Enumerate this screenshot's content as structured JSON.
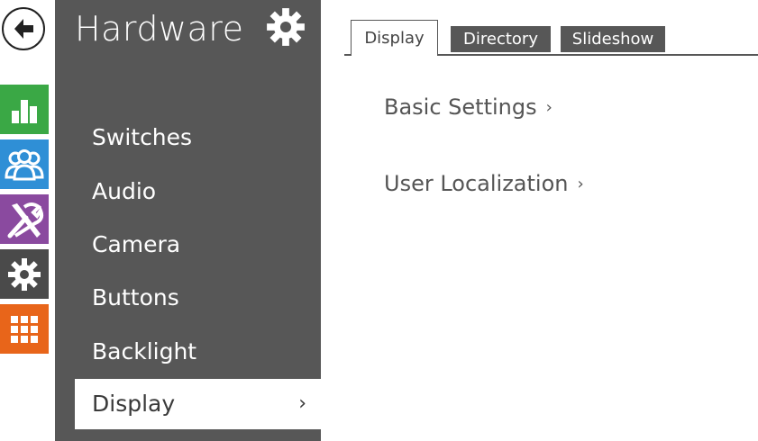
{
  "colors": {
    "status_green": "#3aa845",
    "users_blue": "#2f8fd6",
    "services_purple": "#8a4a9f",
    "hardware_gray": "#4a4a4a",
    "system_orange": "#e8651a",
    "sidebar_bg": "#575757"
  },
  "rail": {
    "back_icon": "arrow-left-icon",
    "items": [
      {
        "icon": "bar-chart-icon"
      },
      {
        "icon": "users-icon"
      },
      {
        "icon": "tools-icon"
      },
      {
        "icon": "gear-icon"
      },
      {
        "icon": "grid-icon"
      }
    ]
  },
  "sidebar": {
    "title": "Hardware",
    "title_icon": "gear-icon",
    "items": [
      {
        "label": "Switches"
      },
      {
        "label": "Audio"
      },
      {
        "label": "Camera"
      },
      {
        "label": "Buttons"
      },
      {
        "label": "Backlight"
      },
      {
        "label": "Display",
        "chevron": "›"
      }
    ]
  },
  "tabs": [
    {
      "label": "Display"
    },
    {
      "label": "Directory"
    },
    {
      "label": "Slideshow"
    }
  ],
  "main": {
    "links": [
      {
        "label": "Basic Settings",
        "chevron": "›"
      },
      {
        "label": "User Localization",
        "chevron": "›"
      }
    ]
  }
}
